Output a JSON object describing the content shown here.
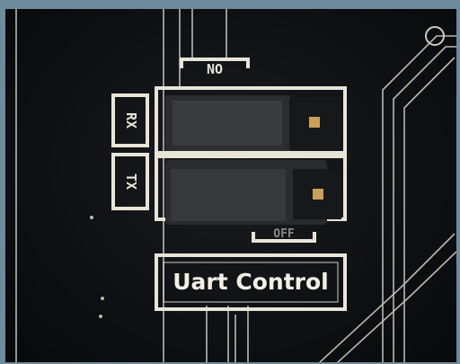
{
  "photo": {
    "subject": "",
    "colors": {
      "pcb": "#0e1013",
      "silkscreen": "#e8e4d8",
      "jumper": "#2c2d30",
      "pin": "#c9a25a",
      "frame": "#6f8a9b"
    }
  },
  "silkscreen": {
    "top_label": "NO",
    "rx_label": "RX",
    "tx_label": "TX",
    "bottom_label": "OFF",
    "uart_label": "Uart Control"
  }
}
